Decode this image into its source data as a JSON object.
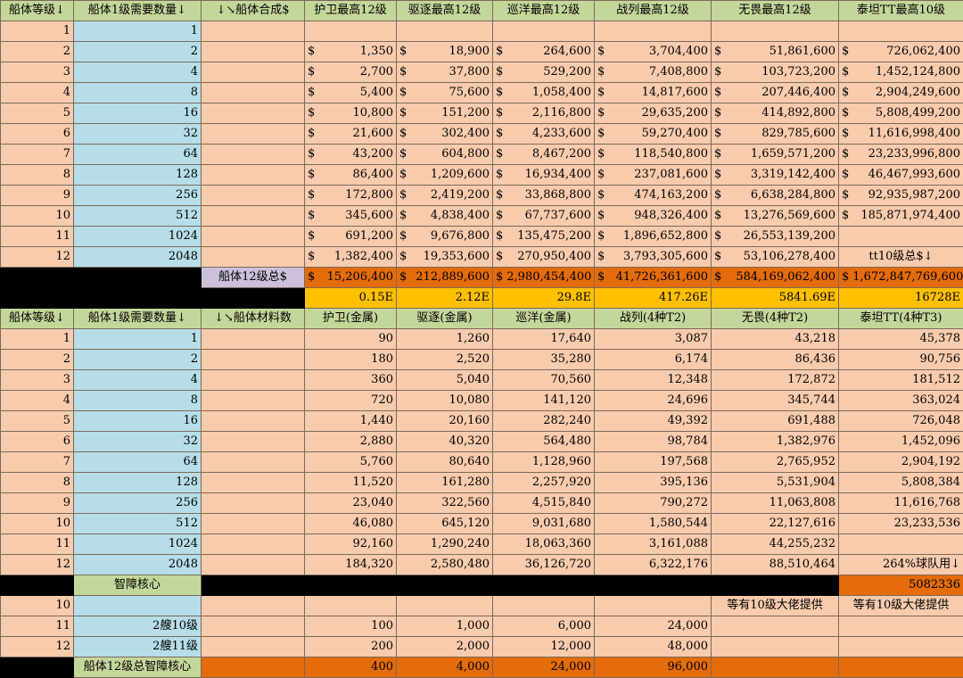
{
  "header1": [
    "船体等级↓",
    "船体1级需要数量↓",
    "↓↘船体合成$",
    "护卫最高12级",
    "驱逐最高12级",
    "巡洋最高12级",
    "战列最高12级",
    "无畏最高12级",
    "泰坦TT最高10级"
  ],
  "cost_rows": [
    [
      "1",
      "1",
      "",
      "",
      "",
      "",
      "",
      "",
      ""
    ],
    [
      "2",
      "2",
      "",
      "1,350",
      "18,900",
      "264,600",
      "3,704,400",
      "51,861,600",
      "726,062,400"
    ],
    [
      "3",
      "4",
      "",
      "2,700",
      "37,800",
      "529,200",
      "7,408,800",
      "103,723,200",
      "1,452,124,800"
    ],
    [
      "4",
      "8",
      "",
      "5,400",
      "75,600",
      "1,058,400",
      "14,817,600",
      "207,446,400",
      "2,904,249,600"
    ],
    [
      "5",
      "16",
      "",
      "10,800",
      "151,200",
      "2,116,800",
      "29,635,200",
      "414,892,800",
      "5,808,499,200"
    ],
    [
      "6",
      "32",
      "",
      "21,600",
      "302,400",
      "4,233,600",
      "59,270,400",
      "829,785,600",
      "11,616,998,400"
    ],
    [
      "7",
      "64",
      "",
      "43,200",
      "604,800",
      "8,467,200",
      "118,540,800",
      "1,659,571,200",
      "23,233,996,800"
    ],
    [
      "8",
      "128",
      "",
      "86,400",
      "1,209,600",
      "16,934,400",
      "237,081,600",
      "3,319,142,400",
      "46,467,993,600"
    ],
    [
      "9",
      "256",
      "",
      "172,800",
      "2,419,200",
      "33,868,800",
      "474,163,200",
      "6,638,284,800",
      "92,935,987,200"
    ],
    [
      "10",
      "512",
      "",
      "345,600",
      "4,838,400",
      "67,737,600",
      "948,326,400",
      "13,276,569,600",
      "185,871,974,400"
    ],
    [
      "11",
      "1024",
      "",
      "691,200",
      "9,676,800",
      "135,475,200",
      "1,896,652,800",
      "26,553,139,200",
      ""
    ],
    [
      "12",
      "2048",
      "",
      "1,382,400",
      "19,353,600",
      "270,950,400",
      "3,793,305,600",
      "53,106,278,400",
      "tt10级总$↓"
    ]
  ],
  "currency": "$",
  "total_label": "船体12级总$",
  "totals": [
    "15,206,400",
    "212,889,600",
    "2,980,454,400",
    "41,726,361,600",
    "584,169,062,400",
    "1,672,847,769,600"
  ],
  "totals_e": [
    "0.15E",
    "2.12E",
    "29.8E",
    "417.26E",
    "5841.69E",
    "16728E"
  ],
  "header2": [
    "船体等级↓",
    "船体1级需要数量↓",
    "↓↘船体材料数",
    "护卫(金属)",
    "驱逐(金属)",
    "巡洋(金属)",
    "战列(4种T2)",
    "无畏(4种T2)",
    "泰坦TT(4种T3)"
  ],
  "mat_rows": [
    [
      "1",
      "1",
      "",
      "90",
      "1,260",
      "17,640",
      "3,087",
      "43,218",
      "45,378"
    ],
    [
      "2",
      "2",
      "",
      "180",
      "2,520",
      "35,280",
      "6,174",
      "86,436",
      "90,756"
    ],
    [
      "3",
      "4",
      "",
      "360",
      "5,040",
      "70,560",
      "12,348",
      "172,872",
      "181,512"
    ],
    [
      "4",
      "8",
      "",
      "720",
      "10,080",
      "141,120",
      "24,696",
      "345,744",
      "363,024"
    ],
    [
      "5",
      "16",
      "",
      "1,440",
      "20,160",
      "282,240",
      "49,392",
      "691,488",
      "726,048"
    ],
    [
      "6",
      "32",
      "",
      "2,880",
      "40,320",
      "564,480",
      "98,784",
      "1,382,976",
      "1,452,096"
    ],
    [
      "7",
      "64",
      "",
      "5,760",
      "80,640",
      "1,128,960",
      "197,568",
      "2,765,952",
      "2,904,192"
    ],
    [
      "8",
      "128",
      "",
      "11,520",
      "161,280",
      "2,257,920",
      "395,136",
      "5,531,904",
      "5,808,384"
    ],
    [
      "9",
      "256",
      "",
      "23,040",
      "322,560",
      "4,515,840",
      "790,272",
      "11,063,808",
      "11,616,768"
    ],
    [
      "10",
      "512",
      "",
      "46,080",
      "645,120",
      "9,031,680",
      "1,580,544",
      "22,127,616",
      "23,233,536"
    ],
    [
      "11",
      "1024",
      "",
      "92,160",
      "1,290,240",
      "18,063,360",
      "3,161,088",
      "44,255,232",
      ""
    ],
    [
      "12",
      "2048",
      "",
      "184,320",
      "2,580,480",
      "36,126,720",
      "6,322,176",
      "88,510,464",
      "264%球队用↓"
    ]
  ],
  "core_label": "智障核心",
  "core_value": "5082336",
  "core_rows": [
    [
      "10",
      "",
      "",
      "",
      "",
      "",
      "",
      "等有10级大佬提供",
      "等有10级大佬提供"
    ],
    [
      "11",
      "2艘10级",
      "",
      "100",
      "1,000",
      "6,000",
      "24,000",
      "",
      ""
    ],
    [
      "12",
      "2艘11级",
      "",
      "200",
      "2,000",
      "12,000",
      "48,000",
      "",
      ""
    ]
  ],
  "core_total_label": "船体12级总智障核心",
  "core_totals": [
    "400",
    "4,000",
    "24,000",
    "96,000",
    "",
    ""
  ]
}
